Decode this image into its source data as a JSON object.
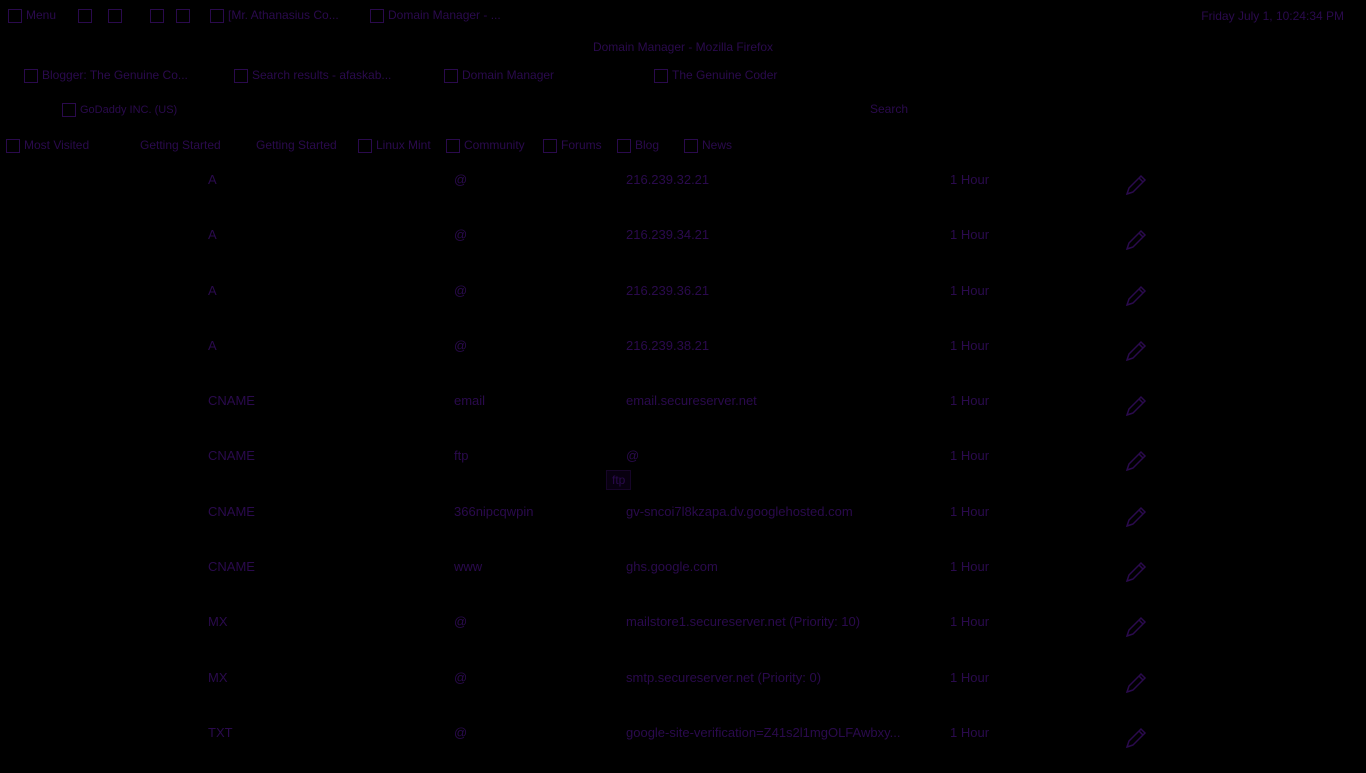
{
  "taskbar": {
    "menu_label": "Menu",
    "app_1": "[Mr. Athanasius Co...",
    "app_2": "Domain Manager - ...",
    "clock": "Friday July 1, 10:24:34 PM"
  },
  "window": {
    "title": "Domain Manager - Mozilla Firefox"
  },
  "tabs": [
    {
      "label": "Blogger: The Genuine Co..."
    },
    {
      "label": "Search results - afaskab..."
    },
    {
      "label": "Domain Manager"
    },
    {
      "label": "The Genuine Coder"
    }
  ],
  "nav": {
    "address": "GoDaddy INC. (US)",
    "search_placeholder": "Search"
  },
  "bookmarks": [
    {
      "label": "Most Visited"
    },
    {
      "label": "Getting Started"
    },
    {
      "label": "Getting Started"
    },
    {
      "label": "Linux Mint"
    },
    {
      "label": "Community"
    },
    {
      "label": "Forums"
    },
    {
      "label": "Blog"
    },
    {
      "label": "News"
    }
  ],
  "dns_records": [
    {
      "type": "A",
      "host": "@",
      "points_to": "216.239.32.21",
      "ttl": "1 Hour"
    },
    {
      "type": "A",
      "host": "@",
      "points_to": "216.239.34.21",
      "ttl": "1 Hour"
    },
    {
      "type": "A",
      "host": "@",
      "points_to": "216.239.36.21",
      "ttl": "1 Hour"
    },
    {
      "type": "A",
      "host": "@",
      "points_to": "216.239.38.21",
      "ttl": "1 Hour"
    },
    {
      "type": "CNAME",
      "host": "email",
      "points_to": "email.secureserver.net",
      "ttl": "1 Hour"
    },
    {
      "type": "CNAME",
      "host": "ftp",
      "points_to": "@",
      "ttl": "1 Hour"
    },
    {
      "type": "CNAME",
      "host": "366nipcqwpin",
      "points_to": "gv-sncoi7l8kzapa.dv.googlehosted.com",
      "ttl": "1 Hour"
    },
    {
      "type": "CNAME",
      "host": "www",
      "points_to": "ghs.google.com",
      "ttl": "1 Hour"
    },
    {
      "type": "MX",
      "host": "@",
      "points_to": "mailstore1.secureserver.net (Priority: 10)",
      "ttl": "1 Hour"
    },
    {
      "type": "MX",
      "host": "@",
      "points_to": "smtp.secureserver.net (Priority: 0)",
      "ttl": "1 Hour"
    },
    {
      "type": "TXT",
      "host": "@",
      "points_to": "google-site-verification=Z41s2l1mgOLFAwbxy...",
      "ttl": "1 Hour"
    }
  ],
  "tooltip": "ftp"
}
